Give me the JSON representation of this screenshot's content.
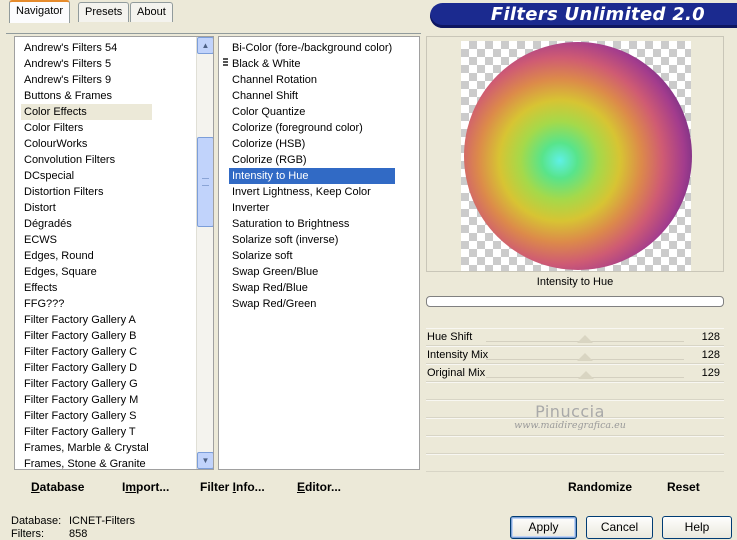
{
  "app": {
    "title": "Filters Unlimited 2.0"
  },
  "tabs": [
    {
      "label": "Navigator",
      "active": true
    },
    {
      "label": "Presets",
      "active": false
    },
    {
      "label": "About",
      "active": false
    }
  ],
  "categories": {
    "selected": "Color Effects",
    "items": [
      "Andrew's Filters 54",
      "Andrew's Filters 5",
      "Andrew's Filters 9",
      "Buttons & Frames",
      "Color Effects",
      "Color Filters",
      "ColourWorks",
      "Convolution Filters",
      "DCspecial",
      "Distortion Filters",
      "Distort",
      "Dégradés",
      "ECWS",
      "Edges, Round",
      "Edges, Square",
      "Effects",
      "FFG???",
      "Filter Factory Gallery A",
      "Filter Factory Gallery B",
      "Filter Factory Gallery C",
      "Filter Factory Gallery D",
      "Filter Factory Gallery G",
      "Filter Factory Gallery M",
      "Filter Factory Gallery S",
      "Filter Factory Gallery T",
      "Frames, Marble & Crystal",
      "Frames, Stone & Granite"
    ]
  },
  "filters": {
    "selected": "Intensity to Hue",
    "items": [
      "Bi-Color (fore-/background color)",
      "Black & White",
      "Channel Rotation",
      "Channel Shift",
      "Color Quantize",
      "Colorize (foreground color)",
      "Colorize (HSB)",
      "Colorize (RGB)",
      "Intensity to Hue",
      "Invert Lightness, Keep Color",
      "Inverter",
      "Saturation to Brightness",
      "Solarize soft (inverse)",
      "Solarize soft",
      "Swap Green/Blue",
      "Swap Red/Blue",
      "Swap Red/Green"
    ]
  },
  "preview": {
    "label": "Intensity to Hue"
  },
  "sliders": [
    {
      "label": "Hue Shift",
      "value": 128,
      "max": 255
    },
    {
      "label": "Intensity Mix",
      "value": 128,
      "max": 255
    },
    {
      "label": "Original Mix",
      "value": 129,
      "max": 255
    }
  ],
  "watermark": {
    "name": "Pinuccia",
    "url": "www.maidiregrafica.eu"
  },
  "toolbar": {
    "database": {
      "u": "D",
      "rest": "atabase"
    },
    "import": {
      "pre": "I",
      "u": "m",
      "rest": "port..."
    },
    "filter_info": {
      "pre": "Filter ",
      "u": "I",
      "rest": "nfo..."
    },
    "editor": {
      "u": "E",
      "rest": "ditor..."
    },
    "randomize": "Randomize",
    "reset": "Reset"
  },
  "info": {
    "database_key": "Database:",
    "database_value": "ICNET-Filters",
    "filters_key": "Filters:",
    "filters_value": "858"
  },
  "buttons": {
    "apply": "Apply",
    "cancel": "Cancel",
    "help": "Help"
  }
}
